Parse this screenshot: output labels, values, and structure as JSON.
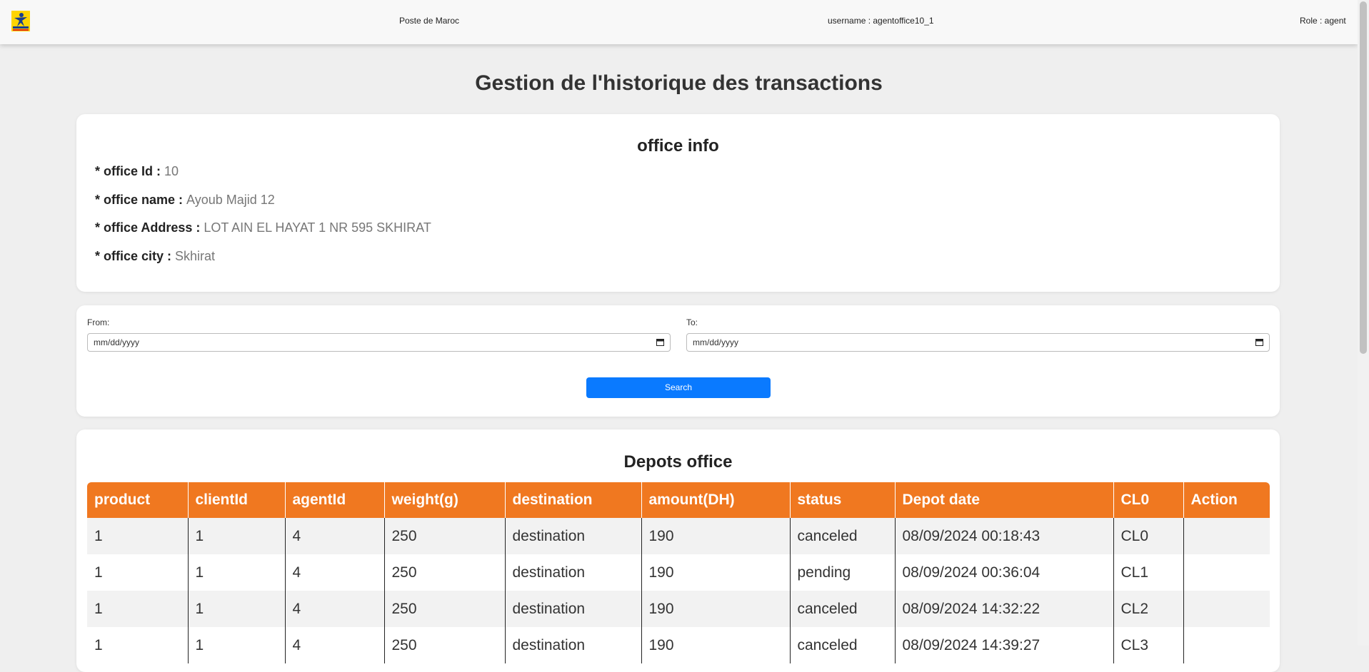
{
  "header": {
    "brand": "Poste de Maroc",
    "username": "username : agentoffice10_1",
    "role": "Role : agent",
    "colors": {
      "logo_bg": "#ffd400",
      "logo_figure": "#1a3e8f"
    }
  },
  "page": {
    "title": "Gestion de l'historique des transactions"
  },
  "office_info": {
    "title": "office info",
    "fields": [
      {
        "label": "* office Id : ",
        "value": "10"
      },
      {
        "label": "* office name : ",
        "value": "Ayoub Majid 12"
      },
      {
        "label": "* office Address : ",
        "value": "LOT AIN EL HAYAT 1 NR 595 SKHIRAT"
      },
      {
        "label": "* office city : ",
        "value": "Skhirat"
      }
    ]
  },
  "filters": {
    "from_label": "From:",
    "from_placeholder": "mm/dd/yyyy",
    "to_label": "To:",
    "to_placeholder": "mm/dd/yyyy",
    "search_label": "Search",
    "accent": "#0a7aff"
  },
  "depots": {
    "title": "Depots office",
    "header_color": "#f07820",
    "columns": [
      "product",
      "clientId",
      "agentId",
      "weight(g)",
      "destination",
      "amount(DH)",
      "status",
      "Depot date",
      "CL0",
      "Action"
    ],
    "rows": [
      [
        "1",
        "1",
        "4",
        "250",
        "destination",
        "190",
        "canceled",
        "08/09/2024 00:18:43",
        "CL0",
        ""
      ],
      [
        "1",
        "1",
        "4",
        "250",
        "destination",
        "190",
        "pending",
        "08/09/2024 00:36:04",
        "CL1",
        ""
      ],
      [
        "1",
        "1",
        "4",
        "250",
        "destination",
        "190",
        "canceled",
        "08/09/2024 14:32:22",
        "CL2",
        ""
      ],
      [
        "1",
        "1",
        "4",
        "250",
        "destination",
        "190",
        "canceled",
        "08/09/2024 14:39:27",
        "CL3",
        ""
      ]
    ]
  }
}
